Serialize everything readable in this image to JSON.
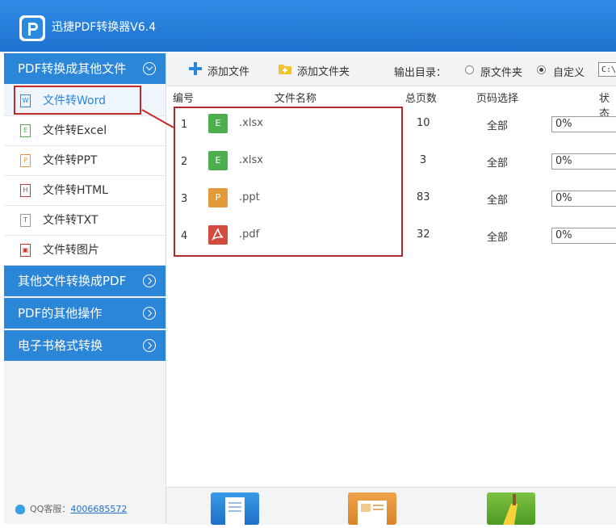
{
  "app": {
    "title": "迅捷PDF转换器V6.4"
  },
  "sidebar": {
    "categories": [
      {
        "label": "PDF转换成其他文件"
      },
      {
        "label": "其他文件转换成PDF"
      },
      {
        "label": "PDF的其他操作"
      },
      {
        "label": "电子书格式转换"
      }
    ],
    "items": [
      {
        "label": "文件转Word",
        "icon": "word-file-icon",
        "glyph": "W"
      },
      {
        "label": "文件转Excel",
        "icon": "excel-file-icon",
        "glyph": "E"
      },
      {
        "label": "文件转PPT",
        "icon": "ppt-file-icon",
        "glyph": "P"
      },
      {
        "label": "文件转HTML",
        "icon": "html-file-icon",
        "glyph": "H"
      },
      {
        "label": "文件转TXT",
        "icon": "txt-file-icon",
        "glyph": "T"
      },
      {
        "label": "文件转图片",
        "icon": "image-file-icon",
        "glyph": "▣"
      }
    ],
    "active_item": "文件转Word",
    "support": {
      "label": "QQ客服：",
      "number": "4006685572"
    }
  },
  "toolbar": {
    "add_file": "添加文件",
    "add_folder": "添加文件夹",
    "output_label": "输出目录：",
    "option_original": "原文件夹",
    "option_custom": "自定义",
    "selected_option": "自定义",
    "path_value": "C:\\"
  },
  "table": {
    "headers": {
      "index": "编号",
      "name": "文件名称",
      "pages": "总页数",
      "page_select": "页码选择",
      "status": "状态"
    },
    "rows": [
      {
        "index": "1",
        "name": "xlsx",
        "ext": ".xlsx",
        "type_letter": "E",
        "pages": "10",
        "page_select": "全部",
        "progress": "0%"
      },
      {
        "index": "2",
        "name": "xlsx",
        "ext": ".xlsx",
        "type_letter": "E",
        "pages": "3",
        "page_select": "全部",
        "progress": "0%"
      },
      {
        "index": "3",
        "name": "ppt",
        "ext": ".ppt",
        "type_letter": "P",
        "pages": "83",
        "page_select": "全部",
        "progress": "0%"
      },
      {
        "index": "4",
        "name": "pdf",
        "ext": ".pdf",
        "type_letter": "",
        "pages": "32",
        "page_select": "全部",
        "progress": "0%"
      }
    ]
  },
  "colors": {
    "title_bar": "#2378d6",
    "category_bg": "#2b86d8",
    "highlight_border": "#c42a2a",
    "excel_green": "#4cae4c",
    "ppt_orange": "#e39a3b",
    "pdf_red": "#d24b3c"
  }
}
